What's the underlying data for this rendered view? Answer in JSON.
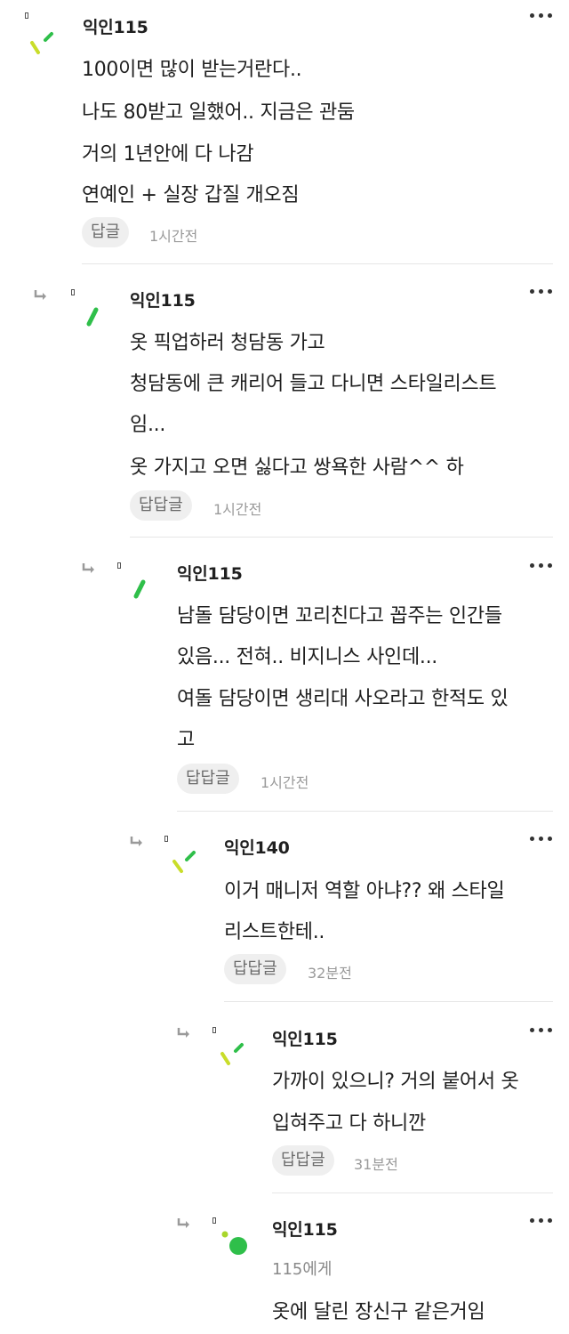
{
  "comments": [
    {
      "author": "익인115",
      "lines": [
        "100이면 많이 받는거란다..",
        "나도 80받고 일했어.. 지금은 관둠",
        "거의 1년안에 다 나감",
        "연예인 + 실장 갑질 개오짐"
      ],
      "reply_label": "답글",
      "time": "1시간전",
      "avatar": "sprout"
    },
    {
      "author": "익인115",
      "lines": [
        "옷 픽업하러 청담동 가고",
        "청담동에 큰 캐리어 들고 다니면 스타일리스트",
        "임...",
        "옷 가지고 오면 싫다고 쌍욕한 사람^^ 하"
      ],
      "reply_label": "답답글",
      "time": "1시간전",
      "avatar": "leaf"
    },
    {
      "author": "익인115",
      "lines": [
        "남돌 담당이면 꼬리친다고 꼽주는 인간들",
        "있음... 전혀.. 비지니스 사인데...",
        "여돌 담당이면 생리대 사오라고 한적도 있",
        "고"
      ],
      "reply_label": "답답글",
      "time": "1시간전",
      "avatar": "leaf"
    },
    {
      "author": "익인140",
      "lines": [
        "이거 매니저 역할 아냐?? 왜 스타일",
        "리스트한테.."
      ],
      "reply_label": "답답글",
      "time": "32분전",
      "avatar": "sprout"
    },
    {
      "author": "익인115",
      "lines": [
        "가까이 있으니? 거의 붙어서 옷",
        "입혀주고 다 하니깐"
      ],
      "reply_label": "답답글",
      "time": "31분전",
      "avatar": "sprout"
    },
    {
      "author": "익인115",
      "mention": "115에게",
      "lines": [
        "옷에 달린 장신구 같은거임"
      ],
      "avatar": "pea"
    }
  ],
  "icons": {
    "more": "more-dots-icon",
    "reply": "reply-arrow-icon",
    "pin": "pin-icon"
  },
  "colors": {
    "green": "#2fbf4a",
    "lime": "#a8d62b",
    "reply_bg": "#efefef",
    "time": "#9a9a9a"
  }
}
